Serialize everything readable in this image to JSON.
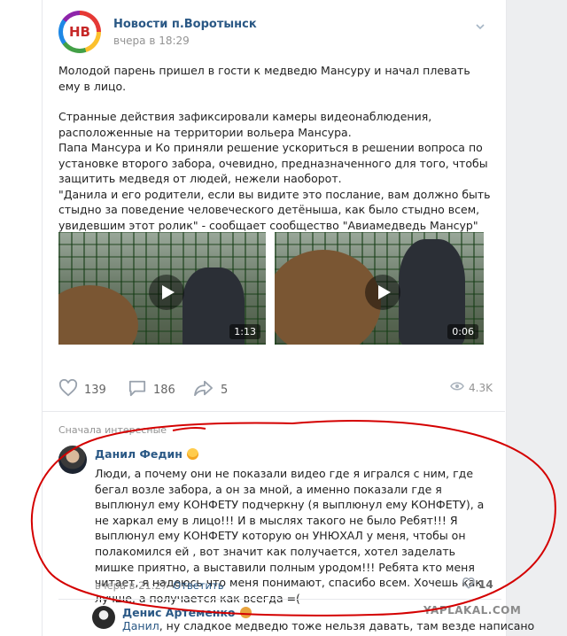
{
  "post": {
    "group_name": "Новости п.Воротынск",
    "logo_text": "НВ",
    "time": "вчера в 18:29",
    "paragraphs": [
      "Молодой парень пришел в гости к медведю Мансуру и начал плевать ему в лицо.",
      "",
      "Странные действия зафиксировали камеры видеонаблюдения, расположенные на территории вольера Мансура.",
      "Папа Мансура и Ко приняли решение ускориться в решении вопроса по установке второго забора, очевидно, предназначенного для того, чтобы защитить медведя от людей, нежели наоборот.",
      "\"Данила и его родители, если вы видите это послание, вам должно быть стыдно за поведение человеческого детёныша, как было стыдно всем, увидевшим этот ролик\" - сообщает сообщество \"Авиамедведь Мансур\""
    ],
    "videos": [
      {
        "duration": "1:13"
      },
      {
        "duration": "0:06"
      }
    ],
    "likes": "139",
    "comments": "186",
    "shares": "5",
    "views": "4.3K"
  },
  "comments_section": {
    "sort_label": "Сначала интересные"
  },
  "comment": {
    "author": "Данил Федин",
    "text": "Люди, а почему они не показали видео где я игрался с ним, где бегал возле забора, а он за мной, а именно показали где я выплюнул ему КОНФЕТУ подчеркну (я выплюнул ему КОНФЕТУ), а не харкал ему в лицо!!! И в мыслях такого не было Ребят!!! Я выплюнул ему КОНФЕТУ которую он УНЮХАЛ у меня, чтобы он полакомился ей , вот значит как получается, хотел заделать мишке приятно, а выставили полным уродом!!! Ребята кто меня читает, я надеюсь что меня понимают, спасибо всем. Хочешь как лучше, а получается как всегда =(",
    "time": "вчера в 21:27",
    "reply_label": "Ответить",
    "likes": "14"
  },
  "reply": {
    "author": "Денис Артеменко",
    "addressee": "Данил",
    "text": ", ну сладкое медведю тоже нельзя давать, там везде написано"
  },
  "watermark": "YAPLAKAL.COM",
  "colors": {
    "link": "#2a5885",
    "muted": "#939393",
    "annotation": "#d40000"
  },
  "icons": [
    "more-icon",
    "heart-icon",
    "comment-icon",
    "share-icon",
    "eye-icon",
    "play-icon"
  ]
}
